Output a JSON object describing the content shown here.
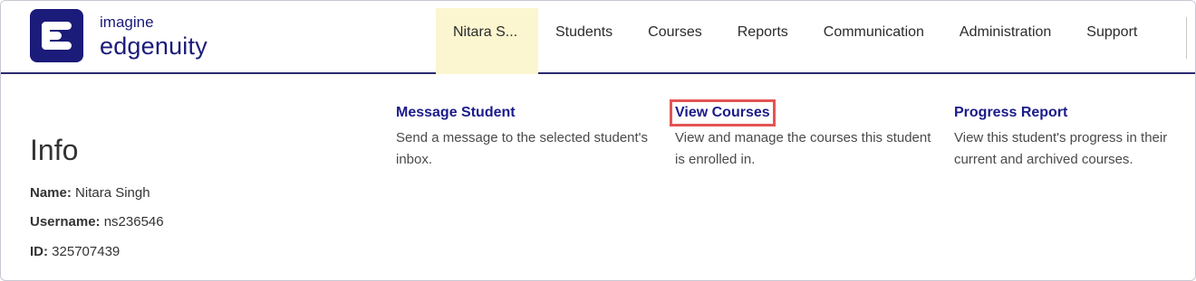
{
  "brand": {
    "line1": "imagine",
    "line2": "edgenuity"
  },
  "nav": {
    "items": [
      {
        "label": "Nitara S..."
      },
      {
        "label": "Students"
      },
      {
        "label": "Courses"
      },
      {
        "label": "Reports"
      },
      {
        "label": "Communication"
      },
      {
        "label": "Administration"
      },
      {
        "label": "Support"
      }
    ]
  },
  "info": {
    "title": "Info",
    "name_label": "Name:",
    "name_value": "Nitara Singh",
    "username_label": "Username:",
    "username_value": "ns236546",
    "id_label": "ID:",
    "id_value": "325707439"
  },
  "actions": [
    {
      "title": "Message Student",
      "desc": "Send a message to the selected student's inbox."
    },
    {
      "title": "View Courses",
      "desc": "View and manage the courses this student is enrolled in."
    },
    {
      "title": "Progress Report",
      "desc": "View this student's progress in their current and archived courses."
    }
  ],
  "colors": {
    "brand": "#1b1b7a",
    "active_nav_bg": "#fbf6d0",
    "highlight": "#e45454",
    "link": "#1b1b8a"
  }
}
